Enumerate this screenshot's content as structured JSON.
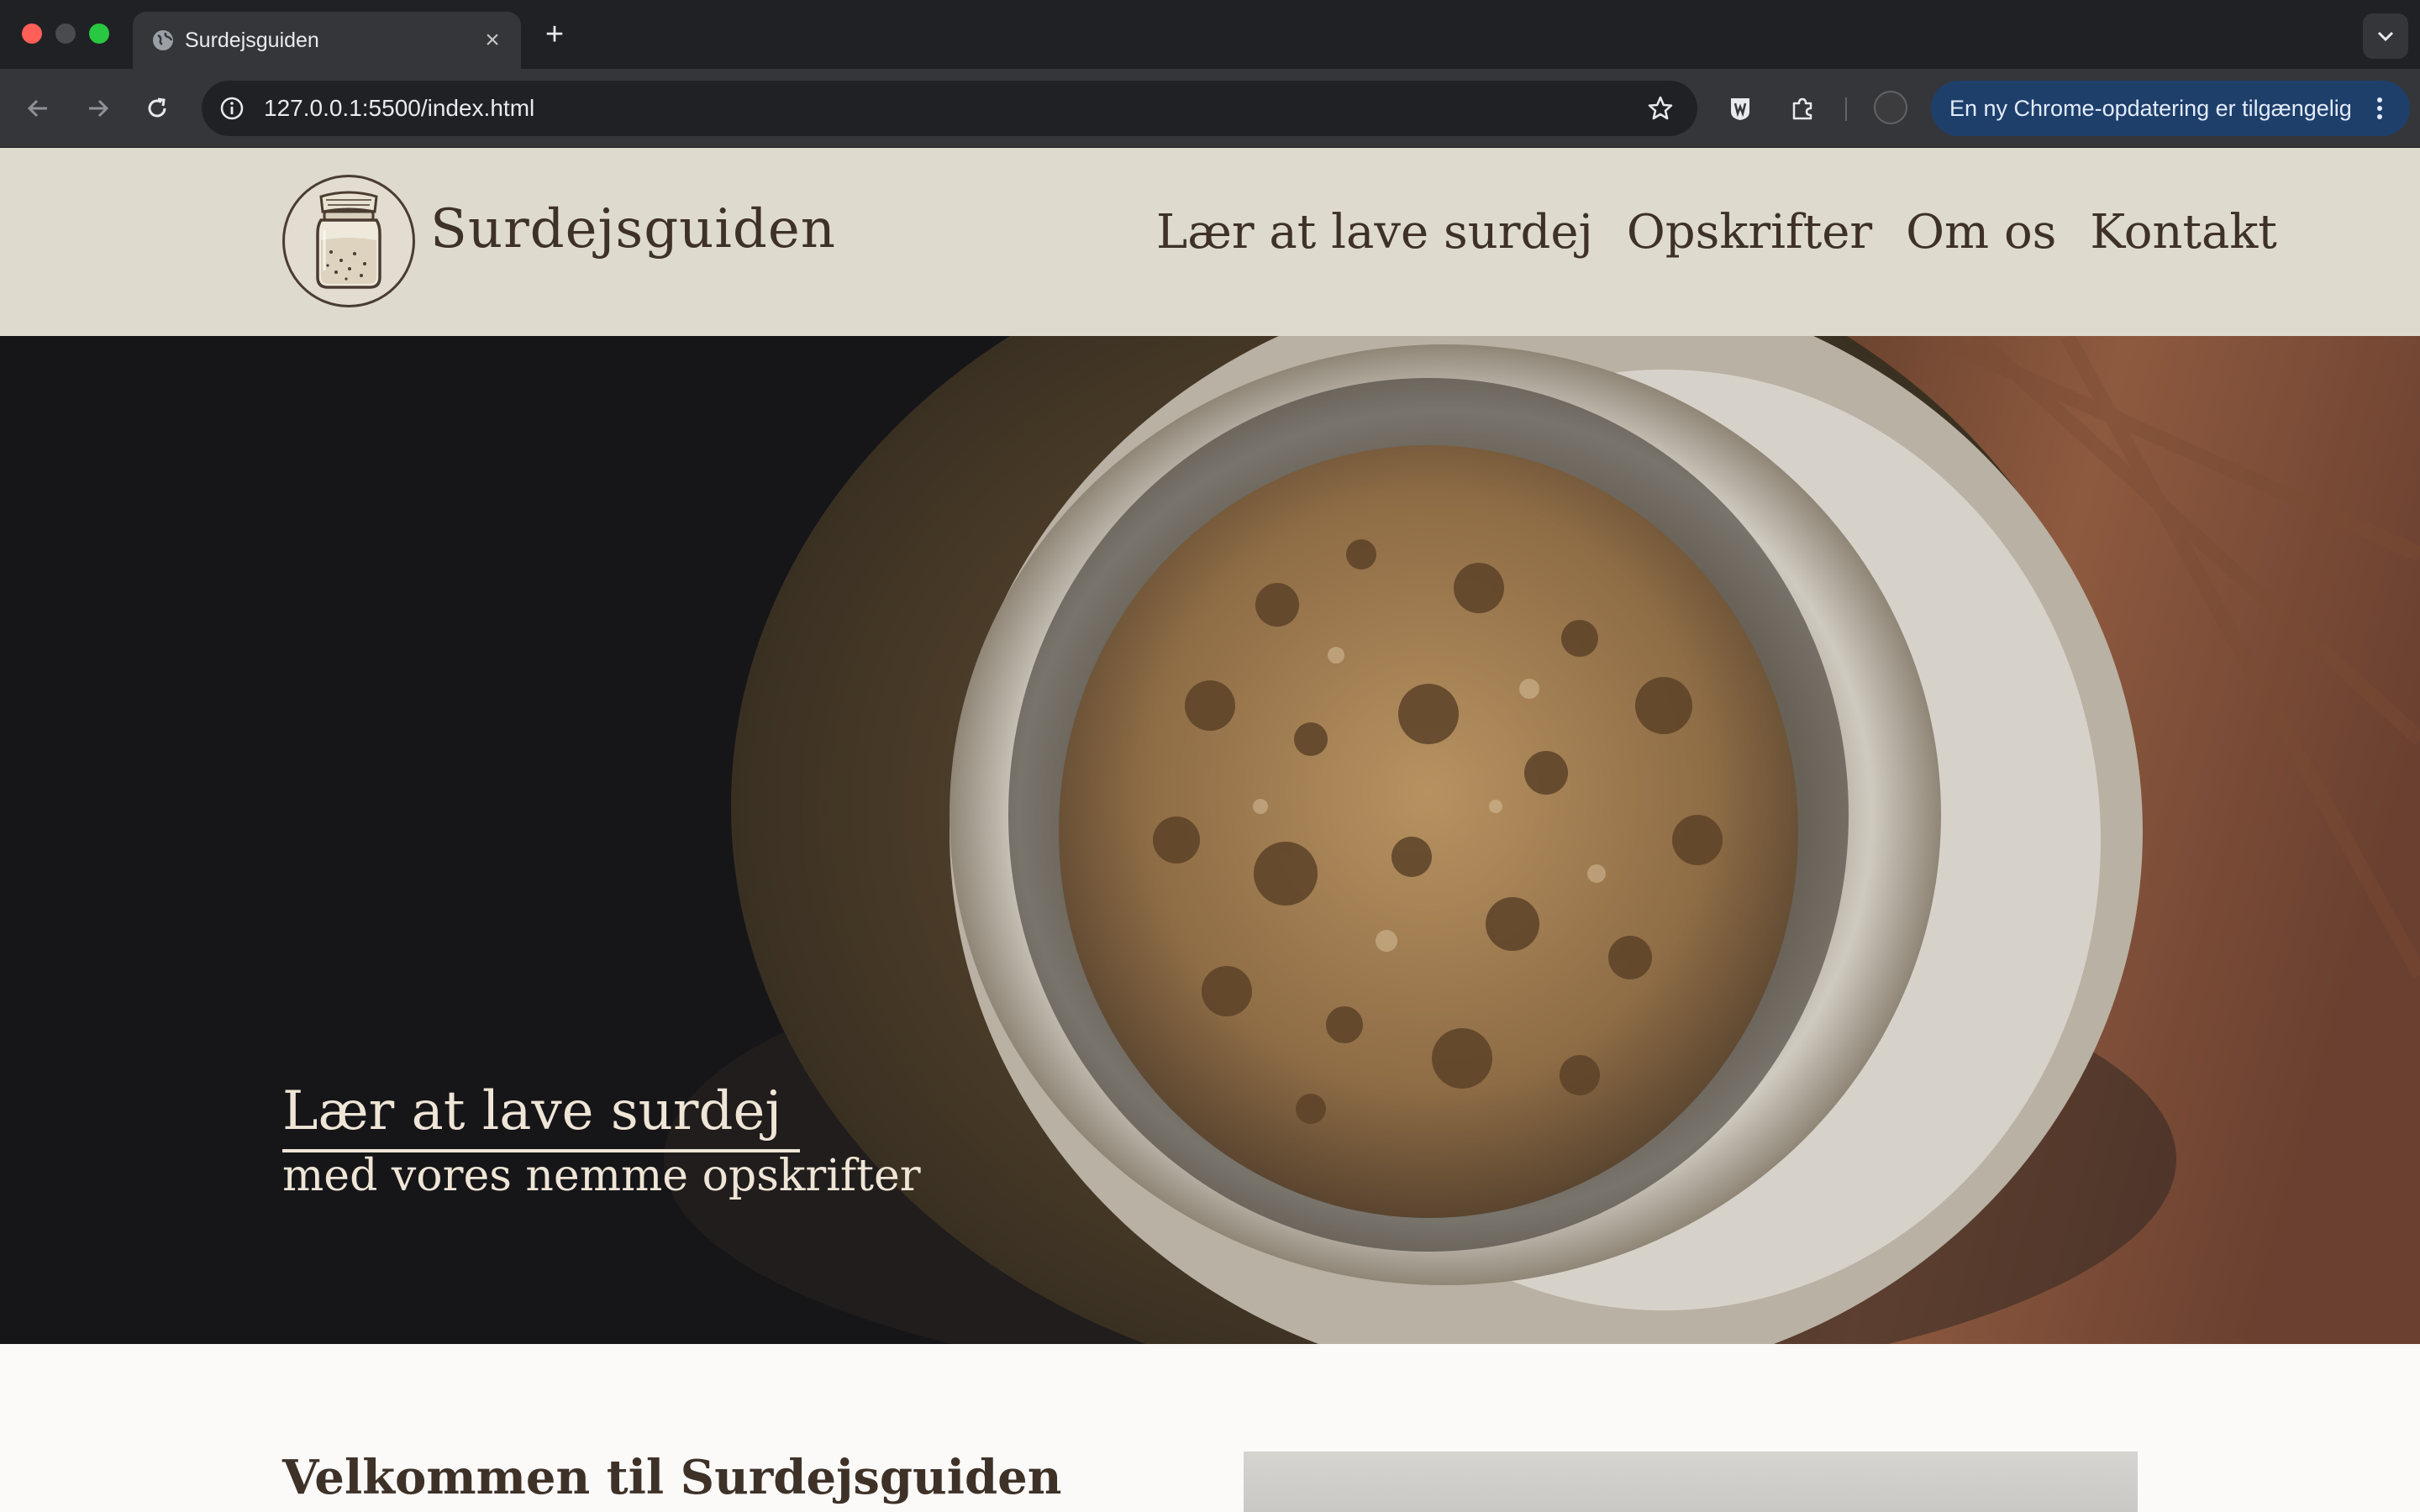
{
  "browser": {
    "tab_title": "Surdejsguiden",
    "url": "127.0.0.1:5500/index.html",
    "update_notice": "En ny Chrome-opdatering er tilgængelig"
  },
  "site": {
    "brand": "Surdejsguiden",
    "nav": [
      "Lær at lave surdej",
      "Opskrifter",
      "Om os",
      "Kontakt"
    ],
    "hero": {
      "title": "Lær at lave surdej",
      "subtitle": "med vores nemme opskrifter"
    },
    "welcome_heading": "Velkommen til Surdejsguiden"
  },
  "colors": {
    "header_bg": "#dedacd",
    "text_brown": "#3e3128",
    "hero_text": "#efe5d6",
    "chrome_dark": "#202124",
    "update_pill": "#1f3f6b"
  },
  "icons": [
    "globe-icon",
    "close-icon",
    "plus-icon",
    "chevron-down-icon",
    "back-arrow-icon",
    "forward-arrow-icon",
    "reload-icon",
    "info-icon",
    "star-icon",
    "extension-icon",
    "puzzle-icon",
    "kebab-menu-icon",
    "jar-logo-icon"
  ]
}
